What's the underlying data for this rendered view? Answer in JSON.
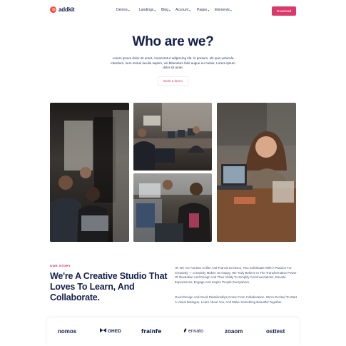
{
  "brand": {
    "name": "addkit",
    "accent": "#d93a6b",
    "navy": "#14204a"
  },
  "nav": {
    "items": [
      {
        "label": "Demos",
        "has_dropdown": true
      },
      {
        "label": "Landings",
        "has_dropdown": true
      },
      {
        "label": "Blog",
        "has_dropdown": true
      },
      {
        "label": "Account",
        "has_dropdown": true
      },
      {
        "label": "Pages",
        "has_dropdown": true
      },
      {
        "label": "Elements",
        "has_dropdown": true
      }
    ],
    "download_label": "Download"
  },
  "hero": {
    "title": "Who are we?",
    "text": "Lorem ipsum dolor sit amet, consectetur adipiscing elit. In pretium, elit quis vehicula interdum, sem metus iaculis sapien, vel bibendum felis augue eu metus. Lorem ipsum dolor sit amet.",
    "cta_label": "Book a demo"
  },
  "photos": [
    {
      "alt": "Team members working at laptops in an office"
    },
    {
      "alt": "Open office with people at computers"
    },
    {
      "alt": "Colleagues collaborating around a laptop"
    },
    {
      "alt": "Smiling woman working at a laptop"
    }
  ],
  "story": {
    "label": "OUR STORY",
    "heading": "We're A Creative Studio That Loves To Learn, And Collaborate.",
    "paragraph_1": "Hi! We Are Annette Collier And Francis Erickson, Two Individuals With A Passion For Creativity — Creativity Makes Us Happy. We Truly Believe In The Transformative Power Of Illustration And Design And Their Ability To Simplify Communications, Elevate Experiences, Engage And Inspire People Everywhere.",
    "paragraph_2": "Good Design And Good Relationships Come From Collaboration. We're Excited To Start A Visual Dialogue, Learn About You, And Make Something Beautiful Together."
  },
  "client_logos": [
    {
      "name": "nomos"
    },
    {
      "name": "OHED"
    },
    {
      "name": "frainfe"
    },
    {
      "name": "envato"
    },
    {
      "name": "zoaom"
    },
    {
      "name": "osttest"
    }
  ]
}
